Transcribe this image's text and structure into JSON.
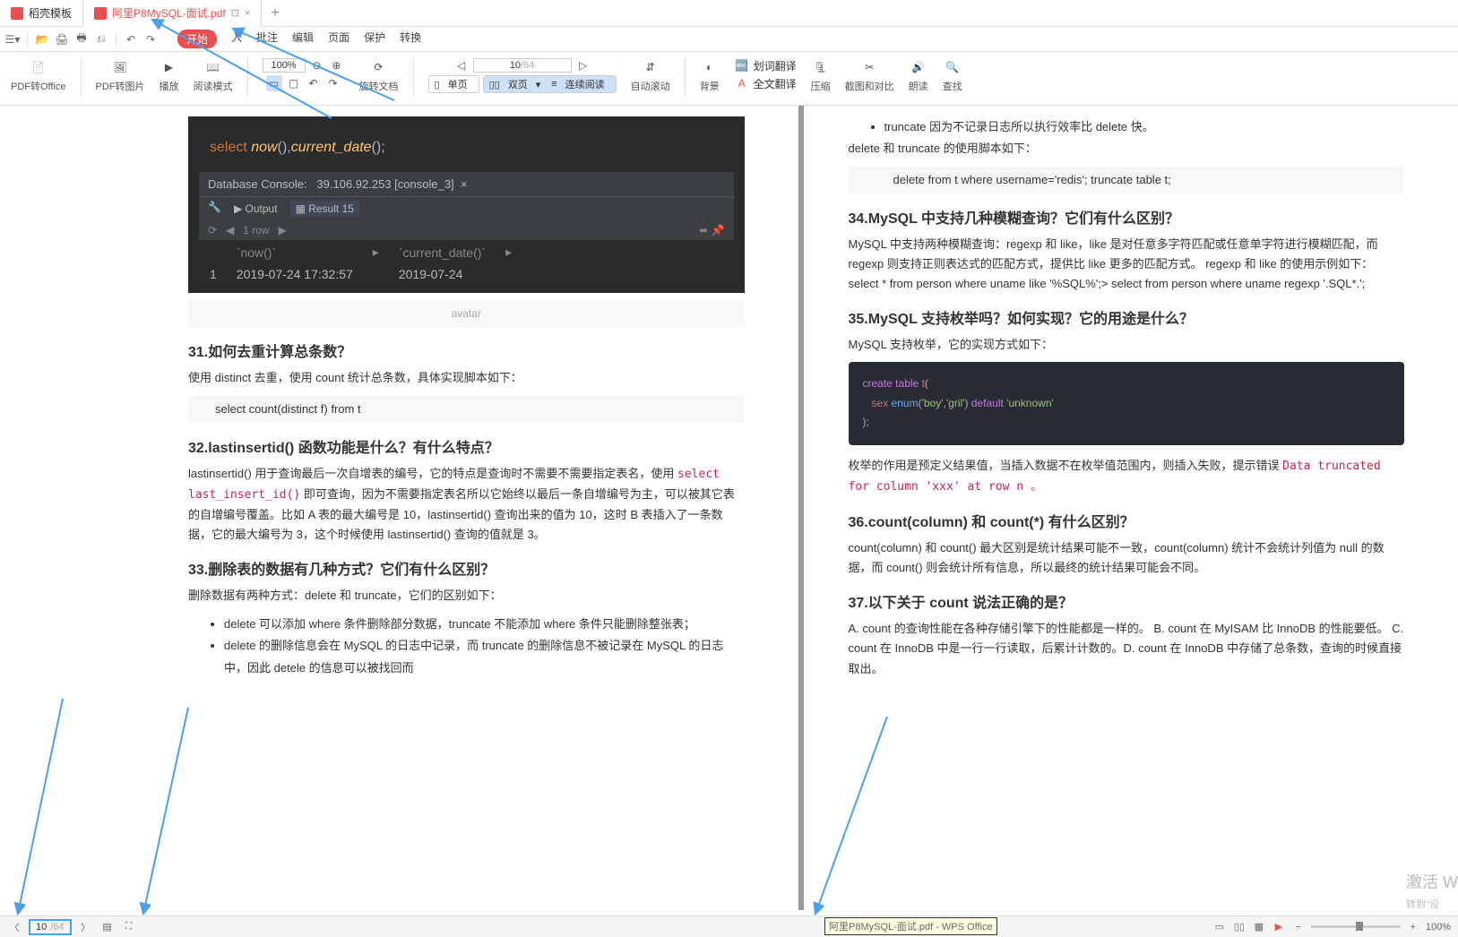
{
  "tabs": {
    "t1": "稻壳模板",
    "t2": "阿里P8MySQL-面试.pdf"
  },
  "menu": {
    "start": "开始",
    "insert": "入",
    "comment": "批注",
    "edit": "编辑",
    "page": "页面",
    "protect": "保护",
    "convert": "转换"
  },
  "ribbon": {
    "pdf2office": "PDF转Office",
    "pdf2pic": "PDF转图片",
    "play": "播放",
    "readmode": "阅读模式",
    "zoom_val": "100%",
    "rotate": "旋转文档",
    "page_cur": "10",
    "page_tot": "/64",
    "single": "单页",
    "double": "双页",
    "continuous": "连续阅读",
    "autoscroll": "自动滚动",
    "background": "背景",
    "dict": "划词翻译",
    "fulltrans": "全文翻译",
    "compress": "压缩",
    "crop": "截图和对比",
    "read_aloud": "朗读",
    "find": "查找"
  },
  "left": {
    "code1_select": "select",
    "code1_now": "now",
    "code1_cd": "current_date",
    "db_console": "Database Console:",
    "db_addr": "39.106.92.253 [console_3]",
    "output": "Output",
    "result": "Result 15",
    "rows": "1 row",
    "col_now": "`now()`",
    "col_cd": "`current_date()`",
    "r_idx": "1",
    "r_now": "2019-07-24 17:32:57",
    "r_cd": "2019-07-24",
    "avatar": "avatar",
    "q31": "31.如何去重计算总条数？",
    "q31_body": "使用 distinct 去重，使用 count 统计总条数，具体实现脚本如下：",
    "q31_code": "select count(distinct f) from t",
    "q32": "32.lastinsertid() 函数功能是什么？有什么特点？",
    "q32_body": "lastinsertid() 用于查询最后一次自增表的编号，它的特点是查询时不需要不需要指定表名，使用 select last_insert_id() 即可查询，因为不需要指定表名所以它始终以最后一条自增编号为主，可以被其它表的自增编号覆盖。比如 A 表的最大编号是 10，lastinsertid() 查询出来的值为 10，这时 B 表插入了一条数据，它的最大编号为 3，这个时候使用 lastinsertid() 查询的值就是 3。",
    "q32_inline": "select last_insert_id()",
    "q33": "33.删除表的数据有几种方式？它们有什么区别？",
    "q33_body": "删除数据有两种方式：delete 和 truncate，它们的区别如下：",
    "q33_b1": "delete 可以添加 where 条件删除部分数据，truncate 不能添加 where 条件只能删除整张表；",
    "q33_b2": "delete 的删除信息会在 MySQL 的日志中记录，而 truncate 的删除信息不被记录在 MySQL 的日志中，因此 detele 的信息可以被找回而"
  },
  "right": {
    "trunc_bullet": "truncate 因为不记录日志所以执行效率比 delete 快。",
    "trunc_body": "delete 和 truncate 的使用脚本如下：",
    "trunc_code": "delete from t where username='redis'; truncate table t;",
    "q34": "34.MySQL 中支持几种模糊查询？它们有什么区别？",
    "q34_body": "MySQL 中支持两种模糊查询：regexp 和 like，like 是对任意多字符匹配或任意单字符进行模糊匹配，而 regexp 则支持正则表达式的匹配方式，提供比 like 更多的匹配方式。 regexp 和 like 的使用示例如下： select * from person where uname like '%SQL%';> select from person where uname regexp '.SQL*.';",
    "q35": "35.MySQL 支持枚举吗？如何实现？它的用途是什么？",
    "q35_body": "MySQL 支持枚举，它的实现方式如下：",
    "code_create": "create table",
    "code_t": "t",
    "code_sex": "sex",
    "code_enum": "enum",
    "code_boy": "'boy'",
    "code_gril": "'gril'",
    "code_default": "default",
    "code_unknown": "'unknown'",
    "q35_body2": "枚举的作用是预定义结果值，当插入数据不在枚举值范围内，则插入失败，提示错误 ",
    "q35_err": "Data truncated for column 'xxx' at row n 。",
    "q36": "36.count(column) 和 count(*) 有什么区别？",
    "q36_body": "count(column) 和 count() 最大区别是统计结果可能不一致，count(column) 统计不会统计列值为 null 的数据，而 count() 则会统计所有信息，所以最终的统计结果可能会不同。",
    "q37": "37.以下关于 count 说法正确的是？",
    "q37_body": "A. count 的查询性能在各种存储引擎下的性能都是一样的。 B. count 在 MyISAM 比 InnoDB 的性能要低。 C. count 在 InnoDB 中是一行一行读取，后累计计数的。D. count 在 InnoDB 中存储了总条数，查询的时候直接取出。"
  },
  "status": {
    "page_cur": "10",
    "page_tot": "/64",
    "tooltip": "阿里P8MySQL-面试.pdf - WPS Office",
    "zoom": "100%",
    "activate": "激活 W",
    "activate2": "转到\"设"
  }
}
